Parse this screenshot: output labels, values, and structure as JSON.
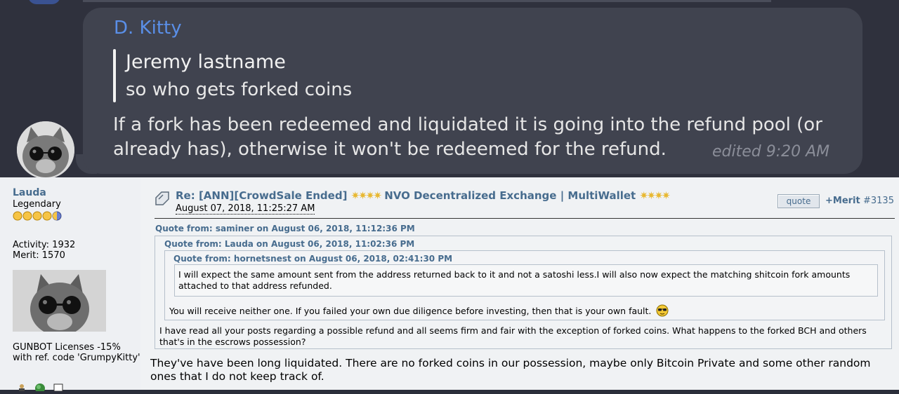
{
  "chat": {
    "sender": "D. Kitty",
    "quote_author": "Jeremy lastname",
    "quote_text": "so who gets forked coins",
    "message_line1": "If a fork has been redeemed and liquidated it is going into the refund pool (or",
    "message_line2": "already has), otherwise it won't be redeemed for the refund.",
    "edited": "edited  9:20 AM",
    "colors": {
      "sender": "#5a8fe8",
      "bubble": "#40434f",
      "background": "#2f313d"
    }
  },
  "forum": {
    "user": {
      "name": "Lauda",
      "rank": "Legendary",
      "activity": "Activity: 1932",
      "merit": "Merit: 1570",
      "signature": "GUNBOT Licenses -15% with ref. code 'GrumpyKitty'"
    },
    "post": {
      "title": "Re: [ANN][CrowdSale Ended]",
      "title_rest": "NVO Decentralized Exchange | MultiWallet",
      "date": "August 07, 2018, 11:25:27 AM",
      "quote_button": "quote",
      "merit_button": "+Merit",
      "post_number": "#3135"
    },
    "quotes": {
      "q1_header": "Quote from: saminer on August 06, 2018, 11:12:36 PM",
      "q2_header": "Quote from: Lauda on August 06, 2018, 11:02:36 PM",
      "q3_header": "Quote from: hornetsnest on August 06, 2018, 02:41:30 PM",
      "q3_text": "I will expect the same amount sent from the address returned back to it and not a satoshi less.I will also now expect the matching shitcoin fork amounts attached to that address refunded.",
      "q2_text": "You will receive neither one. If you failed your own due diligence before investing, then that is your own fault.",
      "q1_text": "I have read all your posts regarding a possible refund and all seems firm and fair with the exception of forked coins. What happens to the forked BCH and others that's in the escrows possession?"
    },
    "reply": "They've have been long liquidated. There are no forked coins in our possession, maybe only Bitcoin Private and some other random ones that I do not keep track of.",
    "colors": {
      "link": "#476c8e",
      "background": "#f0f2f4"
    }
  }
}
